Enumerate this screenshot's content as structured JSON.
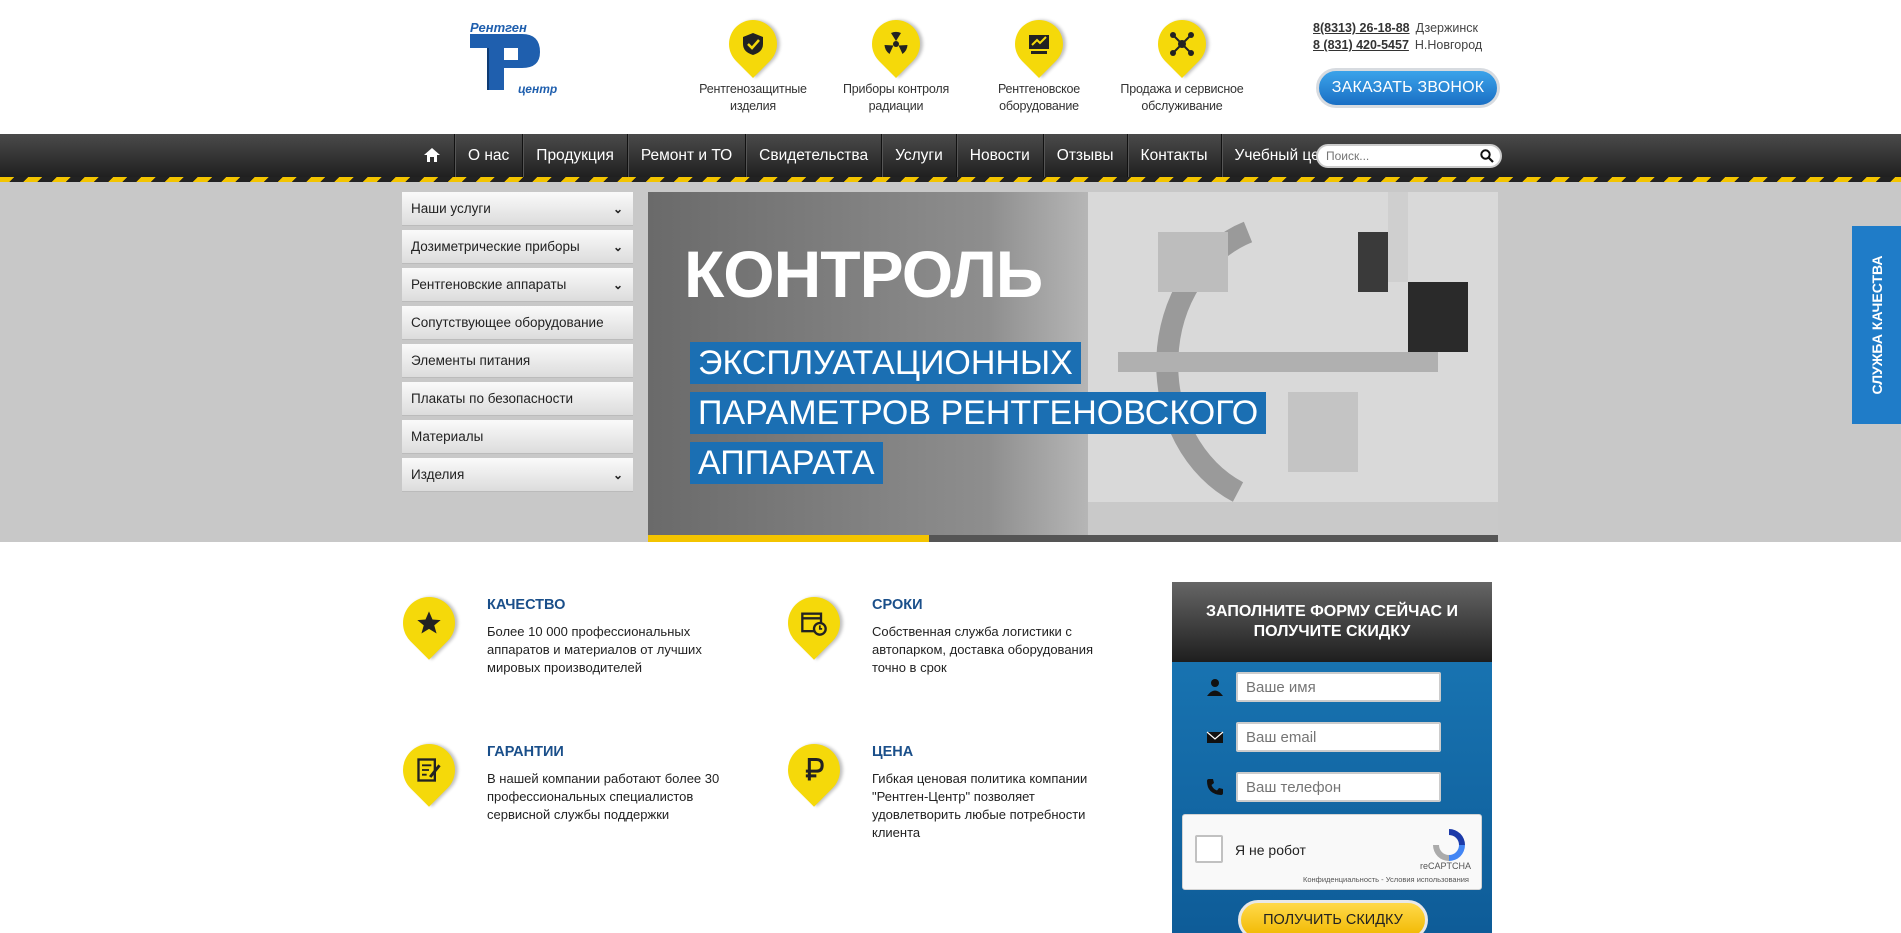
{
  "header": {
    "logo_top": "Рентген",
    "logo_bottom": "центр",
    "categories": [
      {
        "label": "Рентгенозащитные изделия",
        "icon": "shield-check-icon"
      },
      {
        "label": "Приборы контроля радиации",
        "icon": "radiation-icon"
      },
      {
        "label": "Рентгеновское оборудование",
        "icon": "xray-equipment-icon"
      },
      {
        "label": "Продажа и сервисное обслуживание",
        "icon": "network-service-icon"
      }
    ],
    "phones": [
      {
        "number": "8(8313) 26-18-88",
        "city": "Дзержинск"
      },
      {
        "number": "8 (831) 420-5457",
        "city": "Н.Новгород"
      }
    ],
    "call_button": "ЗАКАЗАТЬ ЗВОНОК"
  },
  "nav": {
    "items": [
      "О нас",
      "Продукция",
      "Ремонт и ТО",
      "Свидетельства",
      "Услуги",
      "Новости",
      "Отзывы",
      "Контакты",
      "Учебный центр"
    ],
    "search_placeholder": "Поиск..."
  },
  "sidebar": {
    "items": [
      {
        "label": "Наши услуги",
        "has_sub": true
      },
      {
        "label": "Дозиметрические приборы",
        "has_sub": true
      },
      {
        "label": "Рентгеновские аппараты",
        "has_sub": true
      },
      {
        "label": "Сопутствующее оборудование",
        "has_sub": false
      },
      {
        "label": "Элементы питания",
        "has_sub": false
      },
      {
        "label": "Плакаты по безопасности",
        "has_sub": false
      },
      {
        "label": "Материалы",
        "has_sub": false
      },
      {
        "label": "Изделия",
        "has_sub": true
      }
    ]
  },
  "slider": {
    "title": "КОНТРОЛЬ",
    "lines": [
      "ЭКСПЛУАТАЦИОННЫХ",
      "ПАРАМЕТРОВ РЕНТГЕНОВСКОГО",
      "АППАРАТА"
    ],
    "progress_fraction": 0.33
  },
  "quality_tab": "СЛУЖБА КАЧЕСТВА",
  "features": [
    {
      "title": "КАЧЕСТВО",
      "text": "Более 10 000 профессиональных аппаратов и материалов от лучших мировых производителей",
      "icon": "star-icon"
    },
    {
      "title": "СРОКИ",
      "text": "Собственная служба логистики с автопарком, доставка оборудования точно в срок",
      "icon": "calendar-clock-icon"
    },
    {
      "title": "ГАРАНТИИ",
      "text": "В нашей компании работают более 30 профессиональных специалистов сервисной службы поддержки",
      "icon": "document-pen-icon"
    },
    {
      "title": "ЦЕНА",
      "text": "Гибкая ценовая политика компании \"Рентген-Центр\" позволяет удовлетворить любые потребности клиента",
      "icon": "ruble-icon"
    }
  ],
  "form": {
    "title": "ЗАПОЛНИТЕ ФОРМУ СЕЙЧАС И ПОЛУЧИТЕ СКИДКУ",
    "name_placeholder": "Ваше имя",
    "email_placeholder": "Ваш email",
    "phone_placeholder": "Ваш телефон",
    "captcha_label": "Я не робот",
    "captcha_brand": "reCAPTCHA",
    "captcha_privacy": "Конфиденциальность - Условия использования",
    "submit": "ПОЛУЧИТЬ СКИДКУ"
  },
  "colors": {
    "accent_yellow": "#f5d90a",
    "brand_blue": "#1b6fb3",
    "nav_dark": "#2a2a2a"
  }
}
